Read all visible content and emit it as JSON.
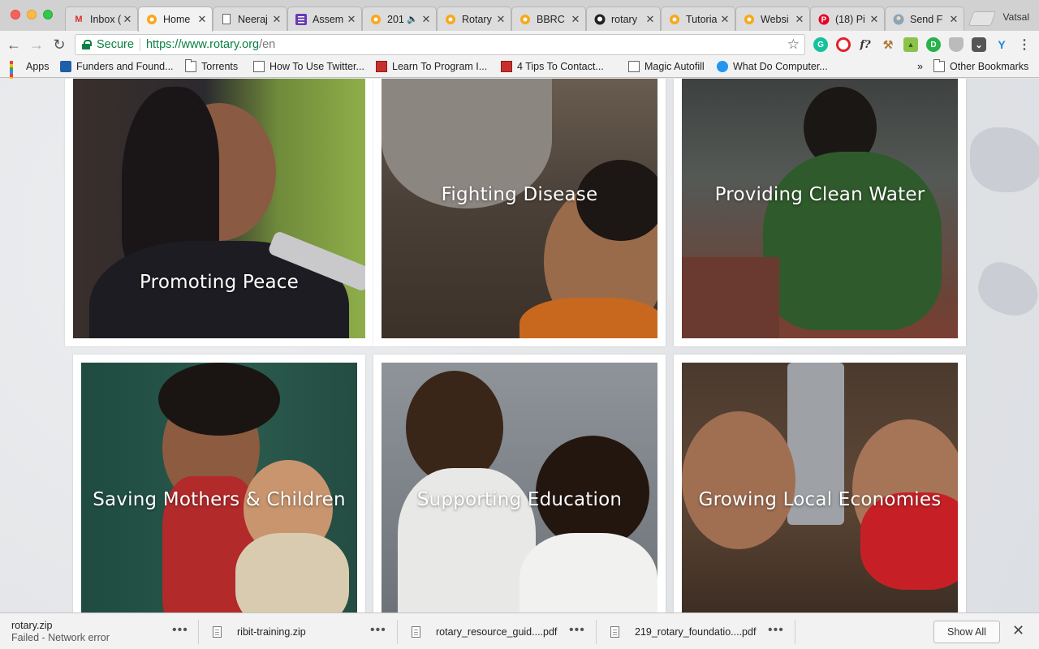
{
  "window": {
    "controls": [
      "close",
      "minimize",
      "zoom"
    ],
    "profile_name": "Vatsal"
  },
  "tabs": [
    {
      "title": "Inbox (",
      "icon": "gmail-icon",
      "active": false
    },
    {
      "title": "Home",
      "icon": "rotary-icon",
      "active": true
    },
    {
      "title": "Neeraj",
      "icon": "page-icon",
      "active": false
    },
    {
      "title": "Assem",
      "icon": "list-icon",
      "active": false
    },
    {
      "title": "201",
      "icon": "rotary-icon",
      "active": false,
      "audio": true
    },
    {
      "title": "Rotary",
      "icon": "rotary-icon",
      "active": false
    },
    {
      "title": "BBRC",
      "icon": "rotary-icon",
      "active": false
    },
    {
      "title": "rotary",
      "icon": "github-icon",
      "active": false
    },
    {
      "title": "Tutoria",
      "icon": "rotary-icon",
      "active": false
    },
    {
      "title": "Websi",
      "icon": "rotary-icon",
      "active": false
    },
    {
      "title": "(18) Pi",
      "icon": "pinterest-icon",
      "active": false
    },
    {
      "title": "Send F",
      "icon": "avatar-icon",
      "active": false
    }
  ],
  "toolbar": {
    "secure_label": "Secure",
    "url_scheme_host": "https://www.rotary.org",
    "url_path": "/en",
    "extensions": [
      {
        "name": "grammarly-icon",
        "glyph": "G",
        "color": "#15c39a"
      },
      {
        "name": "opera-icon",
        "glyph": "O",
        "color": "#e0232b"
      },
      {
        "name": "formula-icon",
        "glyph": "f?",
        "color": "#333333"
      },
      {
        "name": "hammer-icon",
        "glyph": "⚒",
        "color": "#b0783a"
      },
      {
        "name": "android-icon",
        "glyph": "▲",
        "color": "#6fa83b"
      },
      {
        "name": "d-icon",
        "glyph": "D",
        "color": "#27b34a"
      },
      {
        "name": "shield-icon",
        "glyph": "◆",
        "color": "#999999"
      },
      {
        "name": "pocket-icon",
        "glyph": "⌄",
        "color": "#555555"
      },
      {
        "name": "y-icon",
        "glyph": "Y",
        "color": "#1e88e5"
      }
    ]
  },
  "bookmarks": {
    "apps_label": "Apps",
    "items": [
      {
        "label": "Funders and Found...",
        "icon": "funders-icon"
      },
      {
        "label": "Torrents",
        "icon": "folder-icon"
      },
      {
        "label": "How To Use Twitter...",
        "icon": "page-icon"
      },
      {
        "label": "Learn To Program I...",
        "icon": "red-book-icon"
      },
      {
        "label": "4 Tips To Contact...",
        "icon": "red-book-icon"
      },
      {
        "label": "Magic Autofill",
        "icon": "page-icon"
      },
      {
        "label": "What Do Computer...",
        "icon": "blue-q-icon"
      }
    ],
    "overflow_label": "»",
    "other_label": "Other Bookmarks"
  },
  "cards": [
    {
      "id": "peace",
      "caption": "Promoting Peace"
    },
    {
      "id": "disease",
      "caption": "Fighting Disease"
    },
    {
      "id": "water",
      "caption": "Providing Clean Water"
    },
    {
      "id": "mothers",
      "caption": "Saving Mothers & Children"
    },
    {
      "id": "education",
      "caption": "Supporting Education"
    },
    {
      "id": "economies",
      "caption": "Growing Local Economies"
    }
  ],
  "downloads": {
    "items": [
      {
        "filename": "rotary.zip",
        "status": "Failed - Network error"
      },
      {
        "filename": "ribit-training.zip",
        "status": ""
      },
      {
        "filename": "rotary_resource_guid....pdf",
        "status": ""
      },
      {
        "filename": "219_rotary_foundatio....pdf",
        "status": ""
      }
    ],
    "more_glyph": "•••",
    "show_all_label": "Show All",
    "close_glyph": "✕"
  },
  "colors": {
    "secure_green": "#0b8043",
    "page_background": "#e3e5e8"
  }
}
